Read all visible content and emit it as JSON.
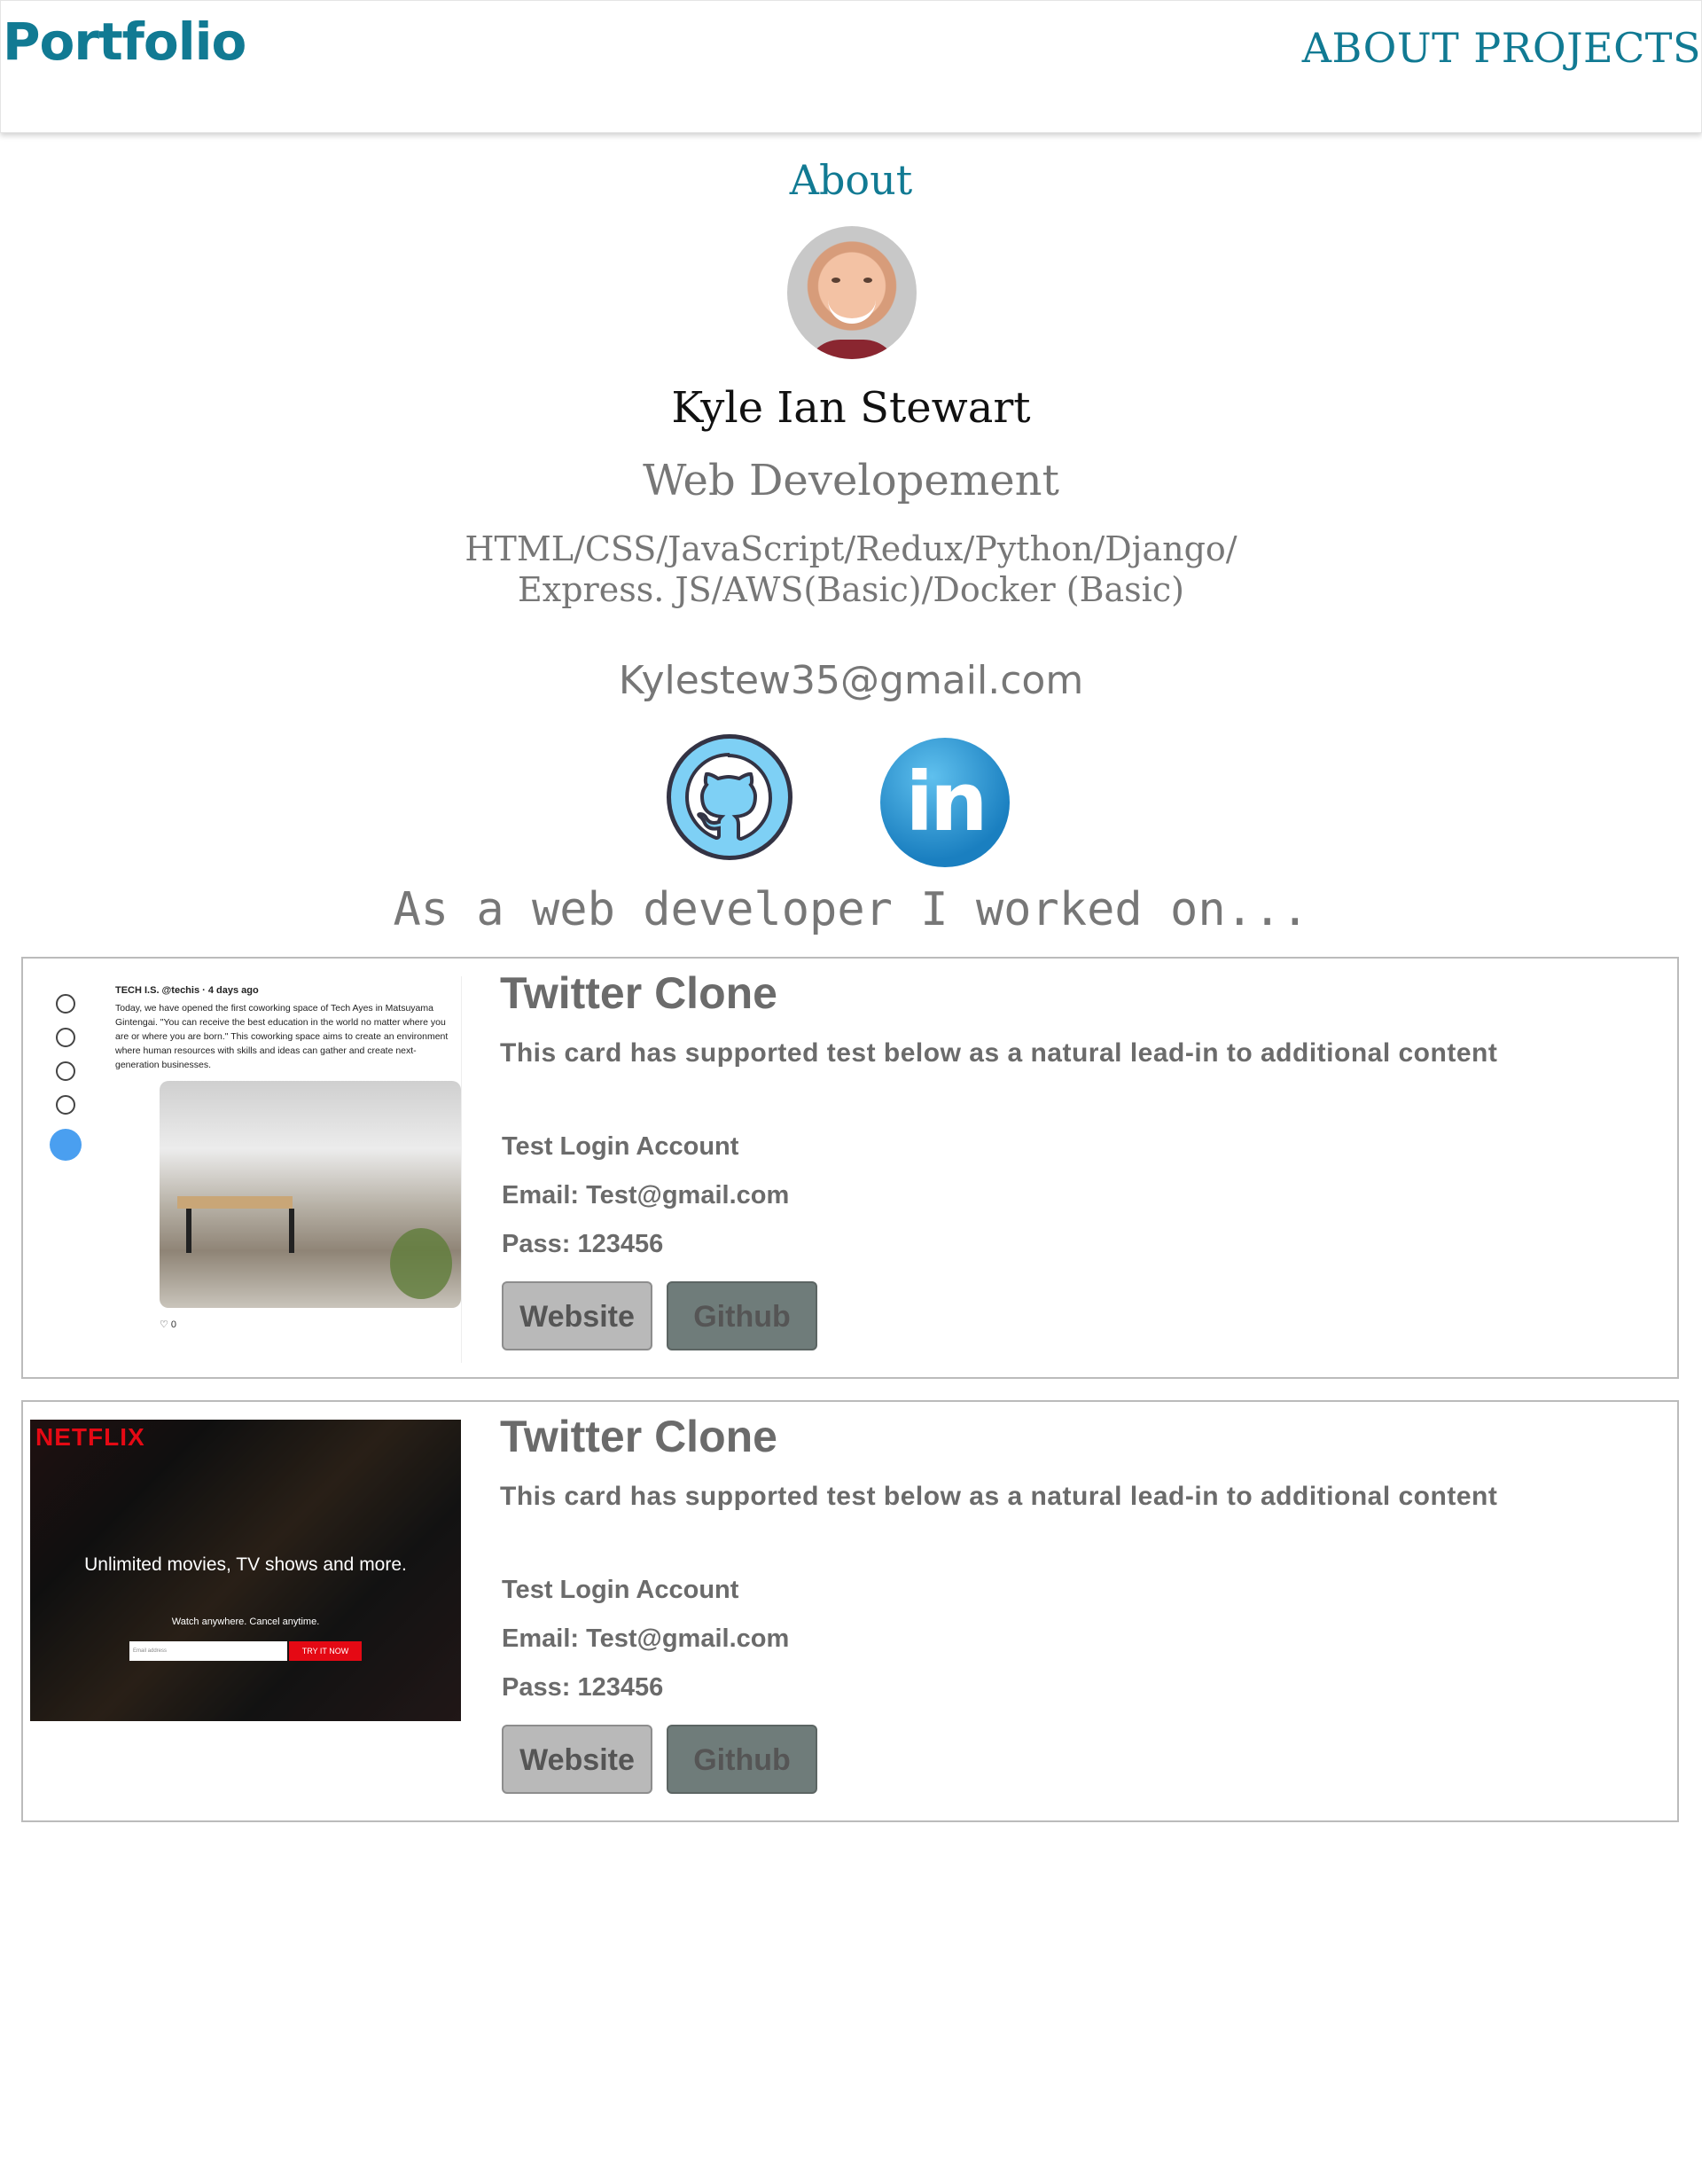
{
  "header": {
    "brand": "Portfolio",
    "nav": [
      "ABOUT",
      "PROJECTS"
    ]
  },
  "about": {
    "title": "About",
    "name": "Kyle Ian Stewart",
    "role": "Web Developement",
    "skills_line1": "HTML/CSS/JavaScript/Redux/Python/Django/",
    "skills_line2": "Express. JS/AWS(Basic)/Docker (Basic)",
    "email": "Kylestew35@gmail.com",
    "linkedin_text": "in",
    "worked_on": "As a web developer I worked on..."
  },
  "projects": [
    {
      "title": "Twitter Clone",
      "text": "This card has supported test below as a natural lead-in to additional content",
      "account_label": "Test Login Account",
      "email": "Email: Test@gmail.com",
      "pass": "Pass: 123456",
      "website_label": "Website",
      "github_label": "Github",
      "thumbnail": {
        "handle": "TECH I.S. @techis · 4 days ago",
        "post": "Today, we have opened the first coworking space of Tech Ayes in Matsuyama Gintengai. \"You can receive the best education in the world no matter where you are or where you are born.\" This coworking space aims to create an environment where human resources with skills and ideas can gather and create next-generation businesses.",
        "likes": "♡ 0"
      }
    },
    {
      "title": "Twitter Clone",
      "text": "This card has supported test below as a natural lead-in to additional content",
      "account_label": "Test Login Account",
      "email": "Email: Test@gmail.com",
      "pass": "Pass: 123456",
      "website_label": "Website",
      "github_label": "Github",
      "thumbnail": {
        "logo": "NETFLIX",
        "headline": "Unlimited movies, TV shows and more.",
        "sub": "Watch anywhere. Cancel anytime.",
        "input_placeholder": "Email address",
        "cta": "TRY IT NOW"
      }
    }
  ],
  "colors": {
    "brand": "#117a93",
    "text_gray": "#6b6b6b",
    "button_website": "#b9b9b9",
    "button_github": "#6f7c7a"
  }
}
